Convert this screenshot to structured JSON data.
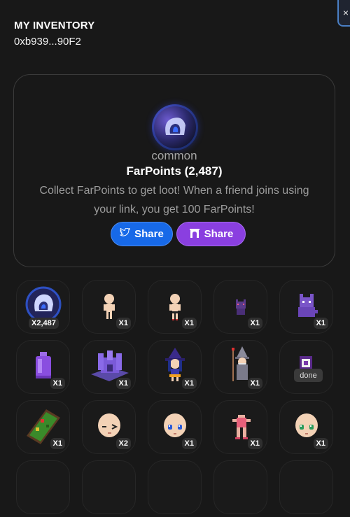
{
  "close_icon": "×",
  "header": {
    "title": "MY INVENTORY",
    "address": "0xb939...90F2"
  },
  "card": {
    "rarity": "common",
    "points_label": "FarPoints (2,487)",
    "description": "Collect FarPoints to get loot! When a friend joins using your link, you get 100 FarPoints!",
    "share_twitter": "Share",
    "share_farcaster": "Share"
  },
  "items": [
    {
      "name": "farpoints-token",
      "count": "X2,487"
    },
    {
      "name": "base-character",
      "count": "X1"
    },
    {
      "name": "base-character-alt",
      "count": "X1"
    },
    {
      "name": "purple-cat",
      "count": "X1"
    },
    {
      "name": "purple-wolf",
      "count": "X1"
    },
    {
      "name": "purple-potion",
      "count": "X1"
    },
    {
      "name": "purple-castle",
      "count": "X1"
    },
    {
      "name": "witch",
      "count": "X1"
    },
    {
      "name": "wizard",
      "count": "X1"
    },
    {
      "name": "banner",
      "status": "done"
    },
    {
      "name": "green-board",
      "count": "X1"
    },
    {
      "name": "head-wink",
      "count": "X2"
    },
    {
      "name": "head-blue-eyes",
      "count": "X1"
    },
    {
      "name": "pink-outfit",
      "count": "X1"
    },
    {
      "name": "head-green-eyes",
      "count": "X1"
    }
  ]
}
